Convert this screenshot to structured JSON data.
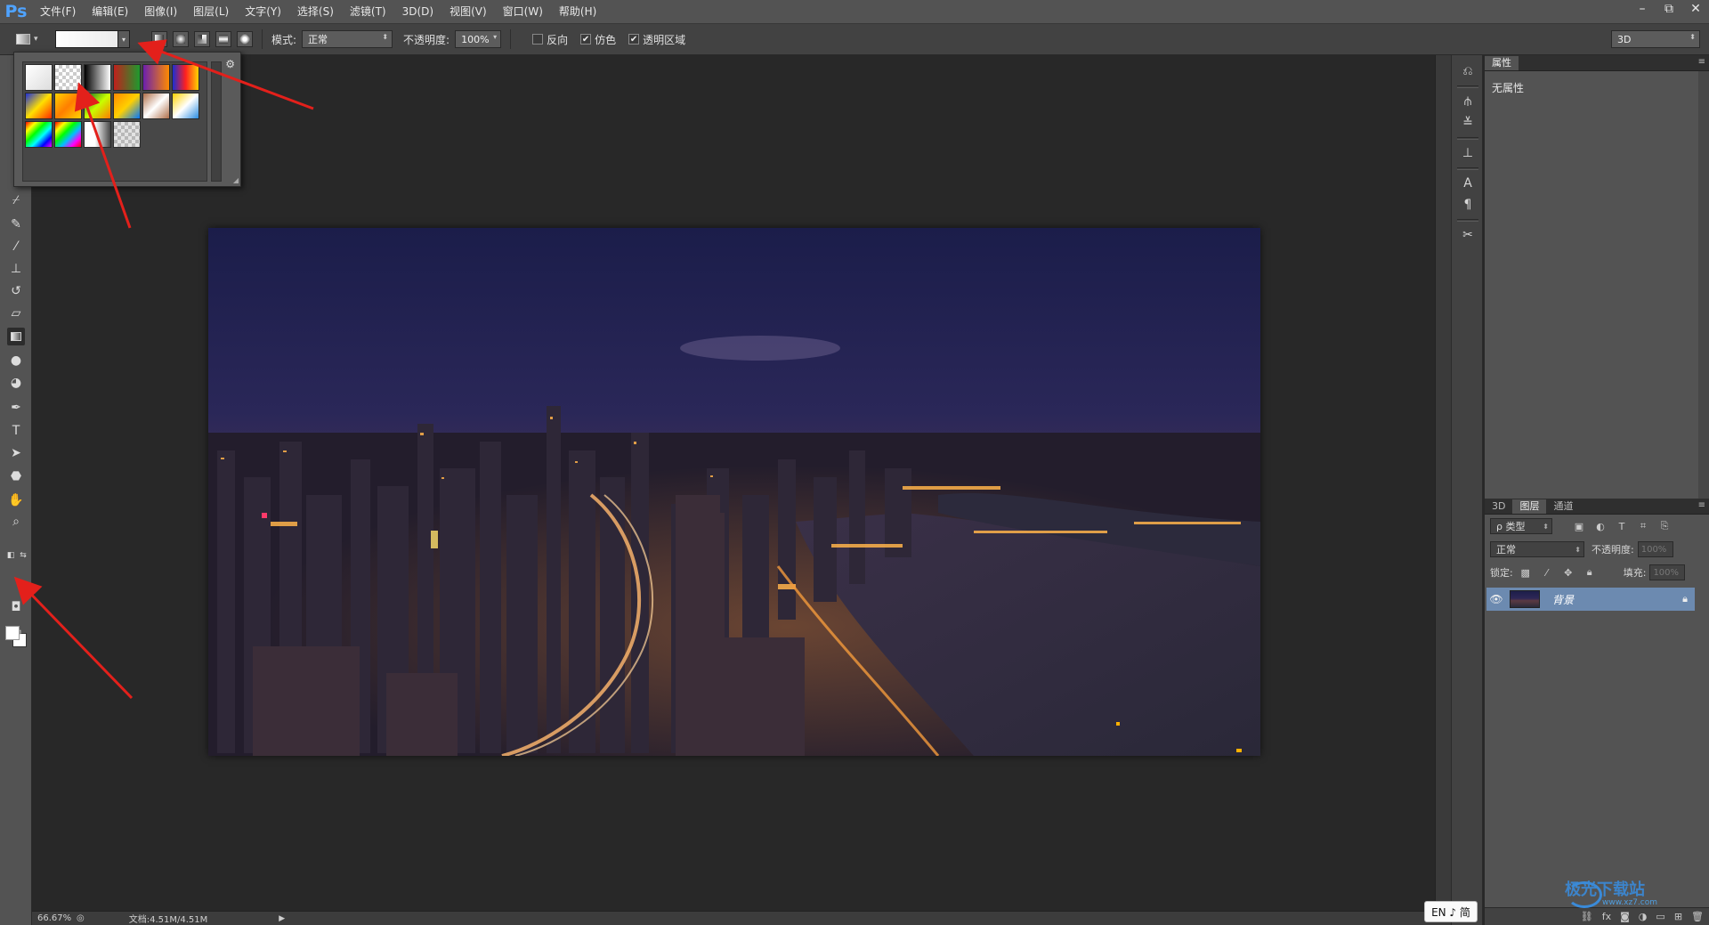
{
  "app": {
    "logo": "Ps"
  },
  "menu": [
    "文件(F)",
    "编辑(E)",
    "图像(I)",
    "图层(L)",
    "文字(Y)",
    "选择(S)",
    "滤镜(T)",
    "3D(D)",
    "视图(V)",
    "窗口(W)",
    "帮助(H)"
  ],
  "window_controls": {
    "minimize": "–",
    "restore": "⧉",
    "close": "✕"
  },
  "options": {
    "mode_label": "模式:",
    "mode_value": "正常",
    "opacity_label": "不透明度:",
    "opacity_value": "100%",
    "reverse_label": "反向",
    "reverse_checked": false,
    "dither_label": "仿色",
    "dither_checked": true,
    "transparency_label": "透明区域",
    "transparency_checked": true,
    "workspace_value": "3D"
  },
  "gradient_picker": {
    "swatches": [
      "linear-gradient(135deg,#ffffff,#dddddd)",
      "checker-white",
      "linear-gradient(90deg,#000000,#ffffff)",
      "linear-gradient(90deg,#c0201c,#1e9a2e)",
      "linear-gradient(90deg,#6b1fae,#ff8a00)",
      "linear-gradient(90deg,#1c2fd2,#ff2020,#ffd400)",
      "linear-gradient(135deg,#1d2fd8,#ffe000,#ff2a00)",
      "linear-gradient(135deg,#ffd200,#ff7e00,#ffd200)",
      "linear-gradient(135deg,#0a6a2a,#c8ff00,#ff7a00)",
      "linear-gradient(135deg,#ff8a00,#ffd000,#0077ff)",
      "linear-gradient(135deg,#b06f4a,#ffffff,#b06f4a)",
      "linear-gradient(135deg,#ffd200,#ffffff,#2a8ce0)",
      "linear-gradient(135deg,#ff0000,#ffff00,#00ff00,#00ffff,#0000ff,#ff00ff)",
      "linear-gradient(135deg,#ff0000,#ffff00,#00ff00,#00c0ff,#ff00ff,#ff0000)",
      "linear-gradient(90deg,#ffffff,#ffffff 40%,transparent)",
      "checker-gray"
    ]
  },
  "properties_panel": {
    "tab": "属性",
    "empty_text": "无属性"
  },
  "layers_panel": {
    "tabs": [
      "3D",
      "图层",
      "通道"
    ],
    "active_tab": "图层",
    "filter_label": "ρ 类型",
    "blend_mode": "正常",
    "opacity_label": "不透明度:",
    "opacity_value": "100%",
    "lock_label": "锁定:",
    "fill_label": "填充:",
    "fill_value": "100%",
    "layer_name": "背景"
  },
  "status": {
    "zoom": "66.67%",
    "doc_info": "文档:4.51M/4.51M"
  },
  "ime": "EN ♪ 简",
  "watermark": {
    "text": "极光下载站",
    "sub": "www.xz7.com"
  }
}
